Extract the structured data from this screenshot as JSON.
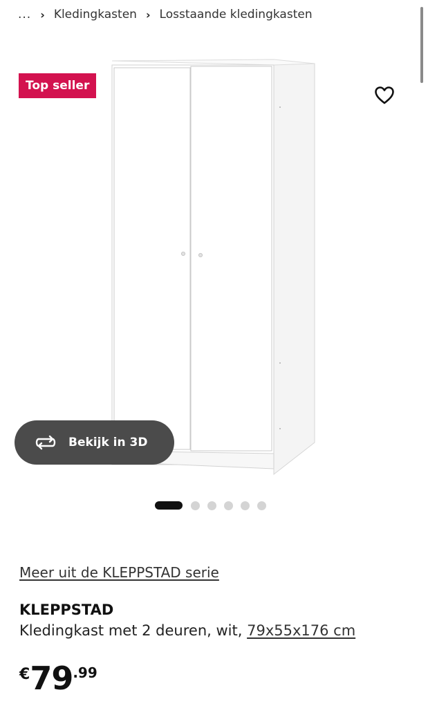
{
  "breadcrumb": {
    "ellipsis": "...",
    "items": [
      "Kledingkasten",
      "Losstaande kledingkasten"
    ]
  },
  "badge": {
    "label": "Top seller",
    "color": "#d3124f"
  },
  "icons": {
    "favorite": "heart-outline-icon",
    "rotate": "rotate-360-icon",
    "chevron": "chevron-right-icon"
  },
  "view3d": {
    "label": "Bekijk in 3D"
  },
  "carousel": {
    "total": 6,
    "active": 1
  },
  "product": {
    "series_link": "Meer uit de KLEPPSTAD serie",
    "name": "KLEPPSTAD",
    "description": "Kledingkast met 2 deuren, wit,",
    "dimensions": "79x55x176 cm"
  },
  "price": {
    "currency": "€",
    "integer": "79",
    "decimal": ".99"
  }
}
